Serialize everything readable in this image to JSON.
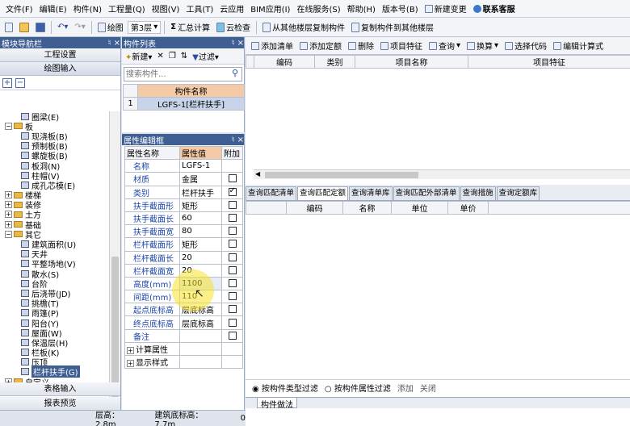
{
  "menu": [
    "文件(F)",
    "编辑(E)",
    "构件(N)",
    "工程量(Q)",
    "视图(V)",
    "工具(T)",
    "云应用",
    "BIM应用(I)",
    "在线服务(S)",
    "帮助(H)",
    "版本号(B)",
    "新建变更",
    "联系客服"
  ],
  "toolbar": {
    "draw": "绘图",
    "floor": "第3层",
    "sum": "汇总计算",
    "cloud_check": "云检查",
    "copy_from": "从其他楼层复制构件",
    "copy_to": "复制构件到其他楼层"
  },
  "nav": {
    "title": "模块导航栏",
    "eng_setup": "工程设置",
    "draw_input": "绘图输入",
    "table_input": "表格输入",
    "report": "报表预览"
  },
  "tree": [
    {
      "label": "圈梁(E)",
      "level": 2,
      "kind": "item"
    },
    {
      "label": "板",
      "level": 1,
      "kind": "open"
    },
    {
      "label": "现浇板(B)",
      "level": 2,
      "kind": "item"
    },
    {
      "label": "预制板(B)",
      "level": 2,
      "kind": "item"
    },
    {
      "label": "螺旋板(B)",
      "level": 2,
      "kind": "item"
    },
    {
      "label": "板洞(N)",
      "level": 2,
      "kind": "item"
    },
    {
      "label": "柱帽(V)",
      "level": 2,
      "kind": "item"
    },
    {
      "label": "成孔芯模(E)",
      "level": 2,
      "kind": "item"
    },
    {
      "label": "楼梯",
      "level": 1,
      "kind": "closed"
    },
    {
      "label": "装修",
      "level": 1,
      "kind": "closed"
    },
    {
      "label": "土方",
      "level": 1,
      "kind": "closed"
    },
    {
      "label": "基础",
      "level": 1,
      "kind": "closed"
    },
    {
      "label": "其它",
      "level": 1,
      "kind": "open"
    },
    {
      "label": "建筑面积(U)",
      "level": 2,
      "kind": "item"
    },
    {
      "label": "天井",
      "level": 2,
      "kind": "item"
    },
    {
      "label": "平整场地(V)",
      "level": 2,
      "kind": "item"
    },
    {
      "label": "散水(S)",
      "level": 2,
      "kind": "item"
    },
    {
      "label": "台阶",
      "level": 2,
      "kind": "item"
    },
    {
      "label": "后浇带(JD)",
      "level": 2,
      "kind": "item"
    },
    {
      "label": "挑檐(T)",
      "level": 2,
      "kind": "item"
    },
    {
      "label": "雨篷(P)",
      "level": 2,
      "kind": "item"
    },
    {
      "label": "阳台(Y)",
      "level": 2,
      "kind": "item"
    },
    {
      "label": "屋面(W)",
      "level": 2,
      "kind": "item"
    },
    {
      "label": "保温层(H)",
      "level": 2,
      "kind": "item"
    },
    {
      "label": "栏板(K)",
      "level": 2,
      "kind": "item"
    },
    {
      "label": "压顶",
      "level": 2,
      "kind": "item"
    },
    {
      "label": "栏杆扶手(G)",
      "level": 2,
      "kind": "item",
      "selected": true
    },
    {
      "label": "自定义",
      "level": 1,
      "kind": "closed"
    }
  ],
  "comp_list": {
    "title": "构件列表",
    "new": "新建",
    "filter": "过滤",
    "search_placeholder": "搜索构件...",
    "col": "构件名称",
    "rows": [
      {
        "no": "1",
        "name": "LGFS-1[栏杆扶手]"
      }
    ]
  },
  "attr": {
    "title": "属性编辑框",
    "cols": [
      "属性名称",
      "属性值",
      "附加"
    ],
    "rows": [
      {
        "name": "名称",
        "value": "LGFS-1",
        "check": null
      },
      {
        "name": "材质",
        "value": "金属",
        "check": false
      },
      {
        "name": "类别",
        "value": "栏杆扶手",
        "check": true
      },
      {
        "name": "扶手截面形",
        "value": "矩形",
        "check": false
      },
      {
        "name": "扶手截面长",
        "value": "60",
        "check": false
      },
      {
        "name": "扶手截面宽",
        "value": "80",
        "check": false
      },
      {
        "name": "栏杆截面形",
        "value": "矩形",
        "check": false
      },
      {
        "name": "栏杆截面长",
        "value": "20",
        "check": false
      },
      {
        "name": "栏杆截面宽",
        "value": "20",
        "check": false
      },
      {
        "name": "高度(mm)",
        "value": "1100",
        "check": false
      },
      {
        "name": "间距(mm)",
        "value": "110",
        "check": false
      },
      {
        "name": "起点底标高",
        "value": "层底标高",
        "check": false
      },
      {
        "name": "终点底标高",
        "value": "层底标高",
        "check": false
      },
      {
        "name": "备注",
        "value": "",
        "check": false
      },
      {
        "name": "计算属性",
        "value": "",
        "check": null,
        "group": true
      },
      {
        "name": "显示样式",
        "value": "",
        "check": null,
        "group": true
      }
    ]
  },
  "right_toolbar": [
    "添加清单",
    "添加定额",
    "删除",
    "项目特征",
    "查询",
    "换算",
    "选择代码",
    "编辑计算式"
  ],
  "upper_cols": [
    "编码",
    "类别",
    "项目名称",
    "项目特征"
  ],
  "tabs": [
    "查询匹配清单",
    "查询匹配定额",
    "查询清单库",
    "查询匹配外部清单",
    "查询措施",
    "查询定额库"
  ],
  "lower_cols": [
    "编码",
    "名称",
    "单位",
    "单价"
  ],
  "filters": {
    "opt1": "按构件类型过滤",
    "opt2": "按构件属性过滤",
    "add": "添加",
    "close": "关闭",
    "bottom_tab": "构件做法"
  },
  "status": {
    "floor_h": "层高：2.8m",
    "base": "建筑底标高：7.7m",
    "num": "0"
  }
}
